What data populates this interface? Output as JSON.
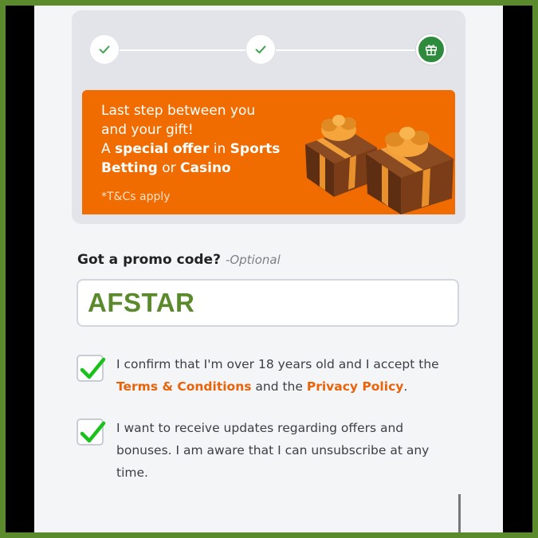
{
  "colors": {
    "frame": "#5b8a2c",
    "banner": "#f06c00",
    "step_active": "#2e8b3d",
    "link": "#e8630a",
    "promo_value": "#5b8a2c"
  },
  "stepper": {
    "steps": [
      {
        "state": "done",
        "icon": "check-icon"
      },
      {
        "state": "done",
        "icon": "check-icon"
      },
      {
        "state": "current",
        "icon": "gift-icon"
      }
    ]
  },
  "banner": {
    "line1": "Last step between you",
    "line2": "and your gift!",
    "line3_pre": "A ",
    "line3_bold": "special offer",
    "line3_post": " in ",
    "line3_bold2": "Sports",
    "line4_bold": "Betting",
    "line4_mid": " or ",
    "line4_bold2": "Casino",
    "tcs": "*T&Cs apply",
    "image": "gift-boxes-image"
  },
  "promo": {
    "label": "Got a promo code?",
    "optional": "-Optional",
    "value": "AFSTAR"
  },
  "consents": [
    {
      "checked": true,
      "text_pre": "I confirm that I'm over 18 years old and I accept the",
      "link1": "Terms & Conditions",
      "text_mid": " and the ",
      "link2": "Privacy Policy",
      "text_post": "."
    },
    {
      "checked": true,
      "text": "I want to receive updates regarding offers and bonuses. I am aware that I can unsubscribe at any time."
    }
  ]
}
